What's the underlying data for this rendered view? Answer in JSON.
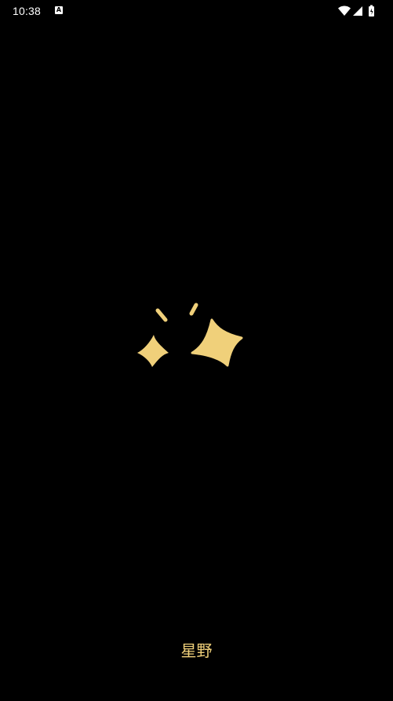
{
  "status_bar": {
    "time": "10:38",
    "notification_icon": "a-notification-icon",
    "wifi_icon": "wifi-icon",
    "signal_icon": "signal-icon",
    "battery_icon": "battery-charging-icon"
  },
  "logo": {
    "icon": "sparkle-stars-icon",
    "color": "#f0d07a"
  },
  "brand": {
    "name": "星野"
  },
  "colors": {
    "background": "#000000",
    "accent": "#f0d07a"
  }
}
